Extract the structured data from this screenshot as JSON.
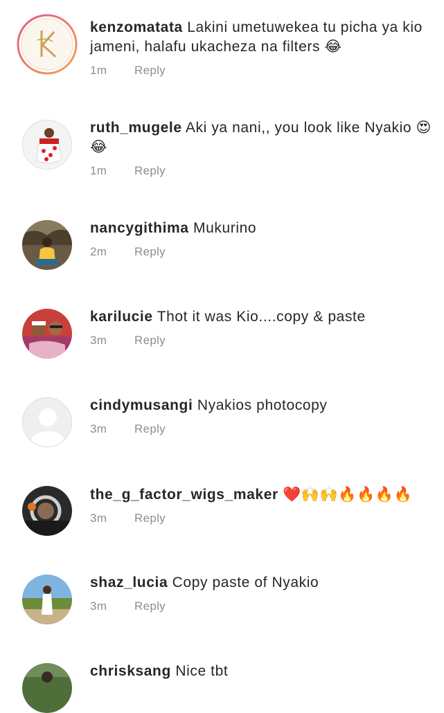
{
  "comments": [
    {
      "username": "kenzomatata",
      "text": "Lakini umetuwekea tu picha ya kio jameni, halafu ukacheza na filters 😂",
      "time": "1m",
      "reply": "Reply",
      "avatar_icon": "kenzo-logo-avatar"
    },
    {
      "username": "ruth_mugele",
      "text": "Aki ya nani,, you look like Nyakio 😍😂",
      "time": "1m",
      "reply": "Reply",
      "avatar_icon": "user-photo-avatar"
    },
    {
      "username": "nancygithima",
      "text": "Mukurino",
      "time": "2m",
      "reply": "Reply",
      "avatar_icon": "user-photo-avatar"
    },
    {
      "username": "karilucie",
      "text": "Thot it was Kio....copy & paste",
      "time": "3m",
      "reply": "Reply",
      "avatar_icon": "user-photo-avatar"
    },
    {
      "username": "cindymusangi",
      "text": "Nyakios photocopy",
      "time": "3m",
      "reply": "Reply",
      "avatar_icon": "default-person-avatar"
    },
    {
      "username": "the_g_factor_wigs_maker",
      "text": "❤️🙌🙌🔥🔥🔥🔥",
      "time": "3m",
      "reply": "Reply",
      "avatar_icon": "user-photo-avatar"
    },
    {
      "username": "shaz_lucia",
      "text": "Copy paste of Nyakio",
      "time": "3m",
      "reply": "Reply",
      "avatar_icon": "user-photo-avatar"
    },
    {
      "username": "chrisksang",
      "text": "Nice tbt",
      "time": "",
      "reply": "",
      "avatar_icon": "user-photo-avatar"
    }
  ],
  "colors": {
    "text": "#262626",
    "meta": "#8e8e8e",
    "kenzo_ring": "#f39a6b",
    "kenzo_gold": "#c9a253"
  }
}
